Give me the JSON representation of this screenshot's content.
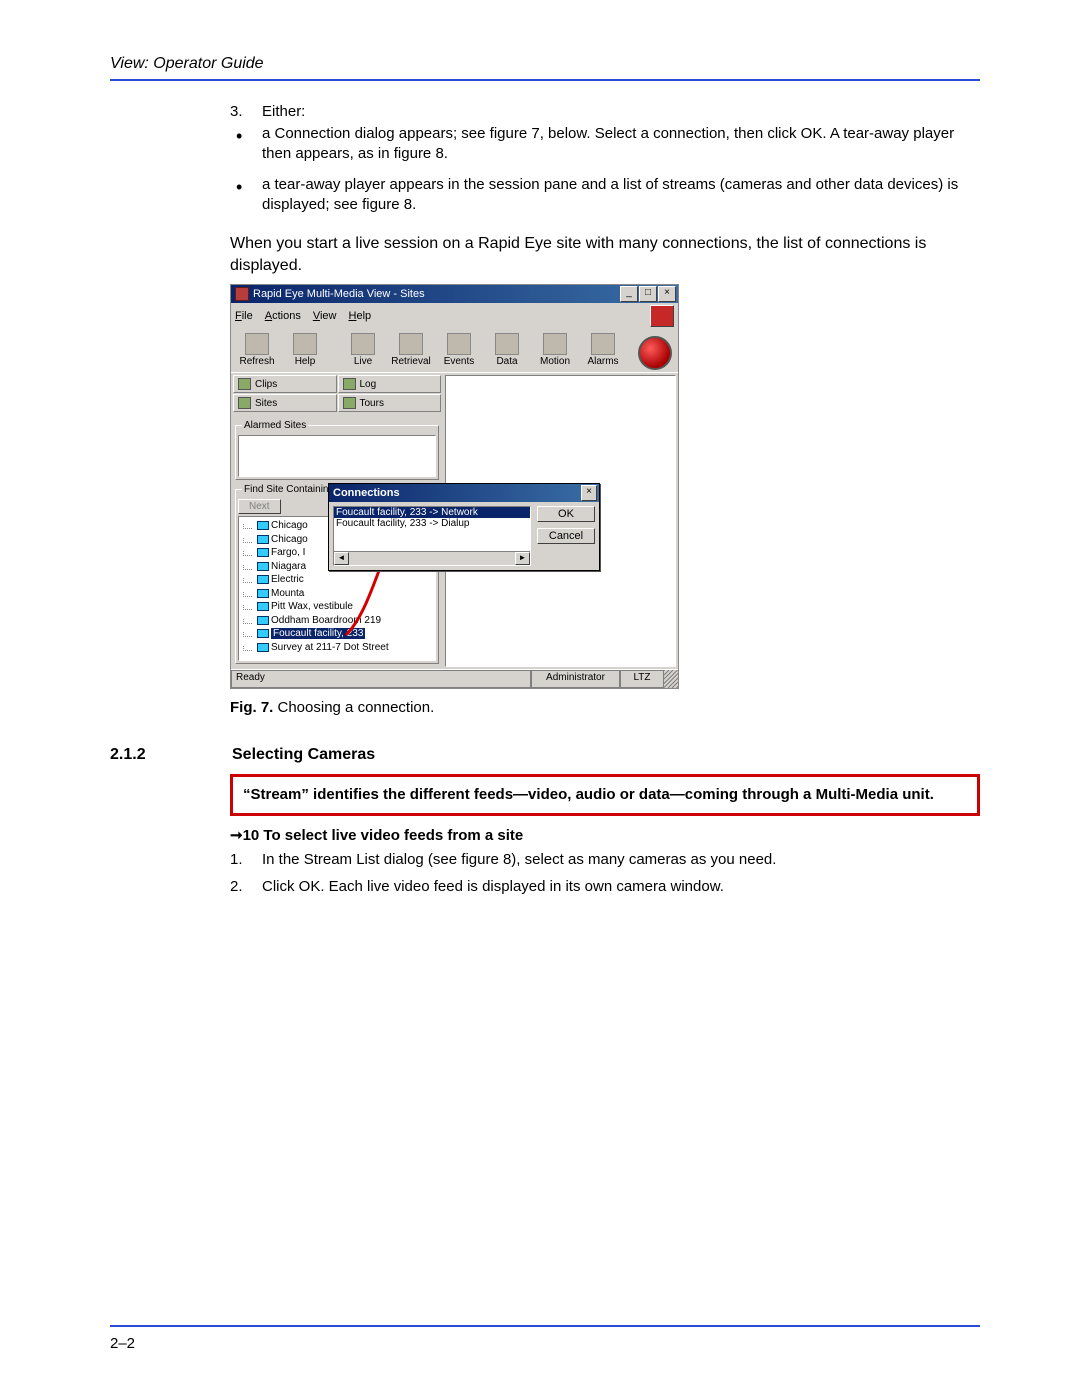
{
  "header": "View: Operator Guide",
  "step3": {
    "num": "3.",
    "label": "Either:"
  },
  "bullets": [
    "a Connection dialog appears; see figure 7, below. Select a connection, then click OK. A tear-away player then appears, as in figure 8.",
    "a tear-away player appears in the session pane and a list of streams (cameras and other data devices) is displayed; see figure 8."
  ],
  "shot_top_caption": "When you start a live session on a Rapid Eye site with many connections, the list of connections is displayed.",
  "app": {
    "title": "Rapid Eye Multi-Media View - Sites",
    "menus": [
      "File",
      "Actions",
      "View",
      "Help"
    ],
    "toolbar": [
      "Refresh",
      "Help",
      "Live",
      "Retrieval",
      "Events",
      "Data",
      "Motion",
      "Alarms"
    ],
    "tabs": [
      "Clips",
      "Log",
      "Sites",
      "Tours"
    ],
    "alarmed_label": "Alarmed Sites",
    "find_label": "Find Site Containing",
    "next_btn": "Next",
    "tree": [
      "Chicago",
      "Chicago",
      "Fargo, I",
      "Niagara",
      "Electric",
      "Mounta",
      "Pitt Wax, vestibule",
      "Oddham Boardroom 219",
      "Foucault facility, 233",
      "Survey at 211-7 Dot Street"
    ],
    "tree_selected_index": 8,
    "status": {
      "left": "Ready",
      "mid": "Administrator",
      "right": "LTZ"
    }
  },
  "conn": {
    "title": "Connections",
    "items": [
      "Foucault facility, 233 -> Network",
      "Foucault facility, 233 -> Dialup"
    ],
    "selected_index": 0,
    "ok": "OK",
    "cancel": "Cancel"
  },
  "fig_label": "Fig. 7.",
  "fig_text": " Choosing a connection.",
  "section": {
    "num": "2.1.2",
    "title": "Selecting Cameras"
  },
  "redbox": "“Stream” identifies the different feeds—video, audio or data—coming through a Multi-Media unit.",
  "leadin": "➞10  To select live video feeds from a site",
  "steps": [
    {
      "n": "1.",
      "t": "In the Stream List dialog (see figure 8), select as many cameras as you need."
    },
    {
      "n": "2.",
      "t": "Click OK. Each live video feed is displayed in its own camera window."
    }
  ],
  "page_num": "2–2"
}
